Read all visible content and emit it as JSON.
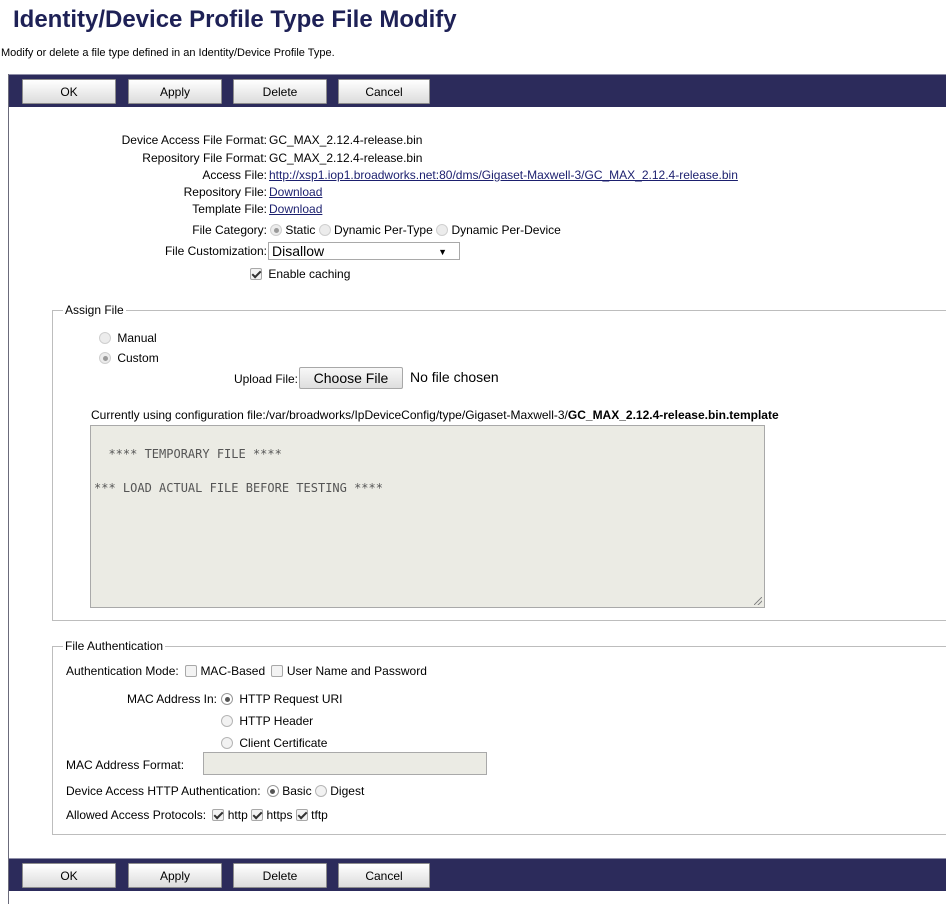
{
  "page": {
    "title": "Identity/Device Profile Type File Modify",
    "subtitle": "Modify or delete a file type defined in an Identity/Device Profile Type."
  },
  "toolbar": {
    "ok_label": "OK",
    "apply_label": "Apply",
    "delete_label": "Delete",
    "cancel_label": "Cancel"
  },
  "colors": {
    "toolbar_bg": "#2c2b5b",
    "title": "#1e2156",
    "link": "#1b1f6e"
  },
  "details": {
    "device_access_label": "Device Access File Format:",
    "device_access_value": "GC_MAX_2.12.4-release.bin",
    "repository_format_label": "Repository File Format:",
    "repository_format_value": "GC_MAX_2.12.4-release.bin",
    "access_file_label": "Access File:",
    "access_file_value": "http://xsp1.iop1.broadworks.net:80/dms/Gigaset-Maxwell-3/GC_MAX_2.12.4-release.bin",
    "repository_file_label": "Repository File:",
    "repository_file_value": "Download",
    "template_file_label": "Template File:",
    "template_file_value": "Download",
    "file_category_label": "File Category:",
    "category_static": "Static",
    "category_dynamic_type": "Dynamic Per-Type",
    "category_dynamic_device": "Dynamic Per-Device",
    "file_customization_label": "File Customization:",
    "file_customization_value": "Disallow",
    "enable_caching_label": "Enable caching"
  },
  "assign_file": {
    "legend": "Assign File",
    "manual_label": "Manual",
    "custom_label": "Custom",
    "upload_label": "Upload File:",
    "choose_file_label": "Choose File",
    "no_file_label": "No file chosen",
    "currently_using_prefix": "Currently using configuration file:",
    "currently_using_path": "/var/broadworks/IpDeviceConfig/type/Gigaset-Maxwell-3/",
    "currently_using_file": "GC_MAX_2.12.4-release.bin.template",
    "contents": "**** TEMPORARY FILE ****\n\n*** LOAD ACTUAL FILE BEFORE TESTING ****"
  },
  "file_auth": {
    "legend": "File Authentication",
    "mode_label": "Authentication Mode:",
    "mac_based_label": "MAC-Based",
    "user_pass_label": "User Name and Password",
    "mac_in_label": "MAC Address In:",
    "http_request_uri": "HTTP Request URI",
    "http_header": "HTTP Header",
    "client_cert": "Client Certificate",
    "mac_format_label": "MAC Address Format:",
    "mac_format_value": "",
    "http_auth_label": "Device Access HTTP Authentication:",
    "basic_label": "Basic",
    "digest_label": "Digest",
    "protocols_label": "Allowed Access Protocols:",
    "http_label": "http",
    "https_label": "https",
    "tftp_label": "tftp"
  }
}
